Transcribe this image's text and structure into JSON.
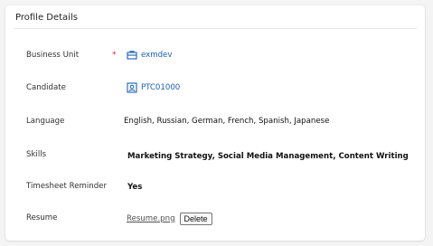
{
  "section": {
    "title": "Profile Details"
  },
  "fields": {
    "business_unit": {
      "label": "Business Unit",
      "required_mark": "*",
      "value": "exmdev",
      "icon": "business-unit-icon"
    },
    "candidate": {
      "label": "Candidate",
      "value": "PTC01000",
      "icon": "candidate-record-icon"
    },
    "language": {
      "label": "Language",
      "value": "English, Russian, German, French, Spanish, Japanese"
    },
    "skills": {
      "label": "Skills",
      "value": "Marketing Strategy, Social Media Management, Content Writing"
    },
    "timesheet_reminder": {
      "label": "Timesheet Reminder",
      "value": "Yes"
    },
    "resume": {
      "label": "Resume",
      "file_name": "Resume.png",
      "delete_label": "Delete"
    }
  },
  "colors": {
    "link": "#1660b3",
    "required": "#c4314b"
  }
}
